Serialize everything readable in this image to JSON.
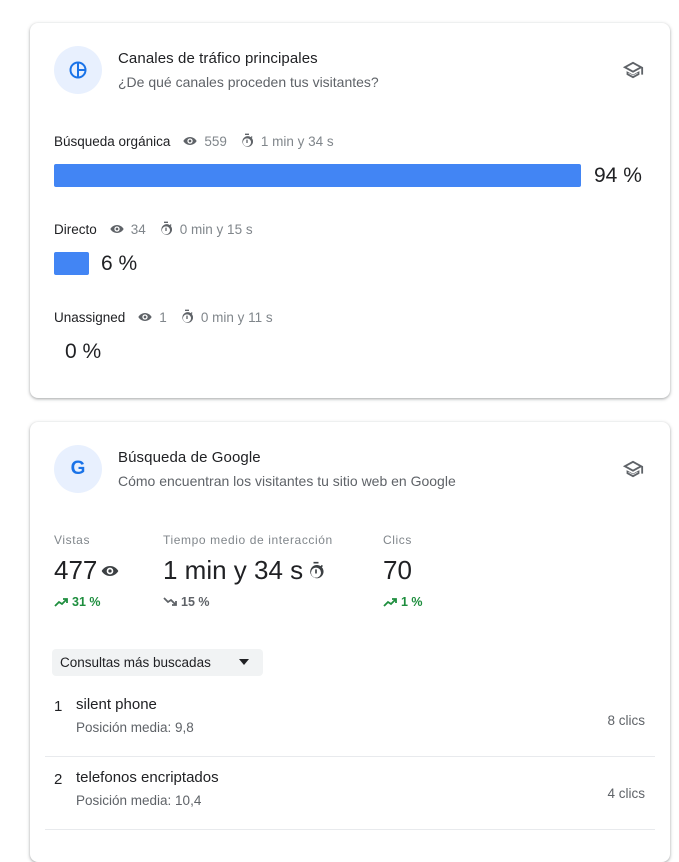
{
  "traffic_card": {
    "title": "Canales de tráfico principales",
    "subtitle": "¿De qué canales proceden tus visitantes?",
    "icon": "pie-chart-icon",
    "channels": [
      {
        "name": "Búsqueda orgánica",
        "views": "559",
        "time": "1 min y 34 s",
        "percent_label": "94 %",
        "share": 0.94
      },
      {
        "name": "Directo",
        "views": "34",
        "time": "0 min y 15 s",
        "percent_label": "6 %",
        "share": 0.06
      },
      {
        "name": "Unassigned",
        "views": "1",
        "time": "0 min y 11 s",
        "percent_label": "0 %",
        "share": 0.0
      }
    ]
  },
  "google_card": {
    "title": "Búsqueda de Google",
    "subtitle": "Cómo encuentran los visitantes tu sitio web en Google",
    "icon_letter": "G",
    "stats": [
      {
        "label": "Vistas",
        "value": "477",
        "trend": "31 %",
        "direction": "up"
      },
      {
        "label": "Tiempo medio de interacción",
        "value": "1 min y 34 s",
        "trend": "15 %",
        "direction": "down"
      },
      {
        "label": "Clics",
        "value": "70",
        "trend": "1 %",
        "direction": "up"
      }
    ],
    "dropdown_label": "Consultas más buscadas",
    "queries": [
      {
        "rank": "1",
        "query": "silent phone",
        "position": "Posición media: 9,8",
        "clicks": "8 clics"
      },
      {
        "rank": "2",
        "query": "telefonos encriptados",
        "position": "Posición media: 10,4",
        "clicks": "4 clics"
      }
    ]
  },
  "colors": {
    "accent": "#4285f4",
    "up": "#1e8e3e",
    "icon_bg": "#e8f0fe"
  }
}
